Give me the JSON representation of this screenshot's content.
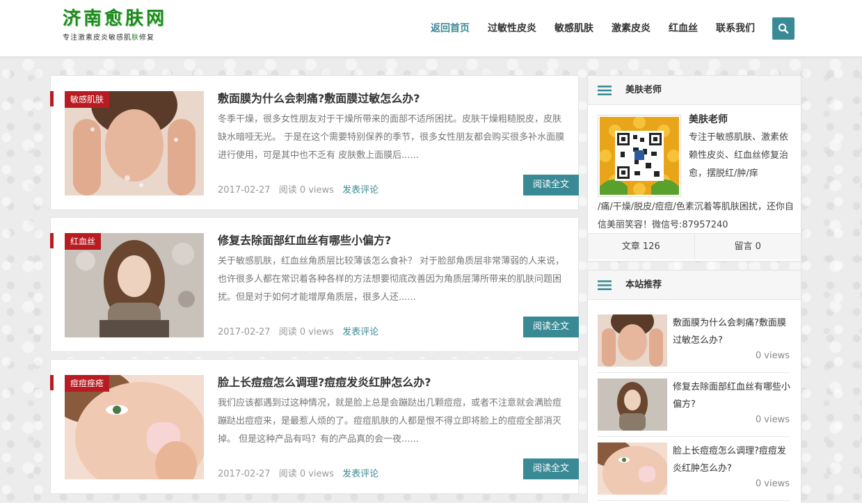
{
  "site": {
    "title": "济南愈肤网",
    "subtitle_a": "专注激素皮炎敏感肌",
    "subtitle_b": "肤",
    "subtitle_c": "修复"
  },
  "nav": {
    "items": [
      {
        "label": "返回首页",
        "active": true
      },
      {
        "label": "过敏性皮炎"
      },
      {
        "label": "敏感肌肤"
      },
      {
        "label": "激素皮炎"
      },
      {
        "label": "红血丝"
      },
      {
        "label": "联系我们"
      }
    ],
    "search_icon": "search-icon"
  },
  "posts": [
    {
      "category": "敏感肌肤",
      "title": "敷面膜为什么会刺痛?敷面膜过敏怎么办?",
      "excerpt": "冬季干燥，很多女性朋友对于干燥所带来的面部不适所困扰。皮肤干燥粗糙脱皮，皮肤缺水暗哑无光。 于是在这个需要特别保养的季节，很多女性朋友都会购买很多补水面膜进行使用，可是其中也不乏有 皮肤敷上面膜后......",
      "date": "2017-02-27",
      "views": "阅读 0 views",
      "comment": "发表评论",
      "read_more": "阅读全文"
    },
    {
      "category": "红血丝",
      "title": "修复去除面部红血丝有哪些小偏方?",
      "excerpt": "关于敏感肌肤，红血丝角质层比较薄该怎么食补？ 对于脸部角质层非常薄弱的人来说，也许很多人都在常识着各种各样的方法想要彻底改善因为角质层薄所带来的肌肤问题困扰。但是对于如何才能增厚角质层，很多人还......",
      "date": "2017-02-27",
      "views": "阅读 0 views",
      "comment": "发表评论",
      "read_more": "阅读全文"
    },
    {
      "category": "痘痘痤疮",
      "title": "脸上长痘痘怎么调理?痘痘发炎红肿怎么办?",
      "excerpt": "我们应该都遇到过这种情况，就是脸上总是会蹦跶出几颗痘痘，或者不注意就会满脸痘蹦跶出痘痘来，是最惹人烦的了。痘痘肌肤的人都是恨不得立即将脸上的痘痘全部消灭掉。 但是这种产品有吗？有的产品真的会一夜......",
      "date": "2017-02-27",
      "views": "阅读 0 views",
      "comment": "发表评论",
      "read_more": "阅读全文"
    }
  ],
  "author_widget": {
    "title": "美肤老师",
    "name": "美肤老师",
    "bio_1": "专注于敏感肌肤、激素依赖性皮炎、红血丝修复治愈，摆脱红/肿/痒",
    "bio_2": "/痛/干燥/脱皮/痘痘/色素沉着等肌肤困扰，还你自信美丽笑容！微信号:87957240",
    "articles": "文章 126",
    "messages": "留言 0"
  },
  "recommend_widget": {
    "title": "本站推荐",
    "items": [
      {
        "title": "敷面膜为什么会刺痛?敷面膜过敏怎么办?",
        "views": "0 views"
      },
      {
        "title": "修复去除面部红血丝有哪些小偏方?",
        "views": "0 views"
      },
      {
        "title": "脸上长痘痘怎么调理?痘痘发炎红肿怎么办?",
        "views": "0 views"
      }
    ]
  },
  "colors": {
    "accent": "#3a8a96",
    "tag_red": "#b81c22",
    "logo_green": "#1d8a1d"
  }
}
